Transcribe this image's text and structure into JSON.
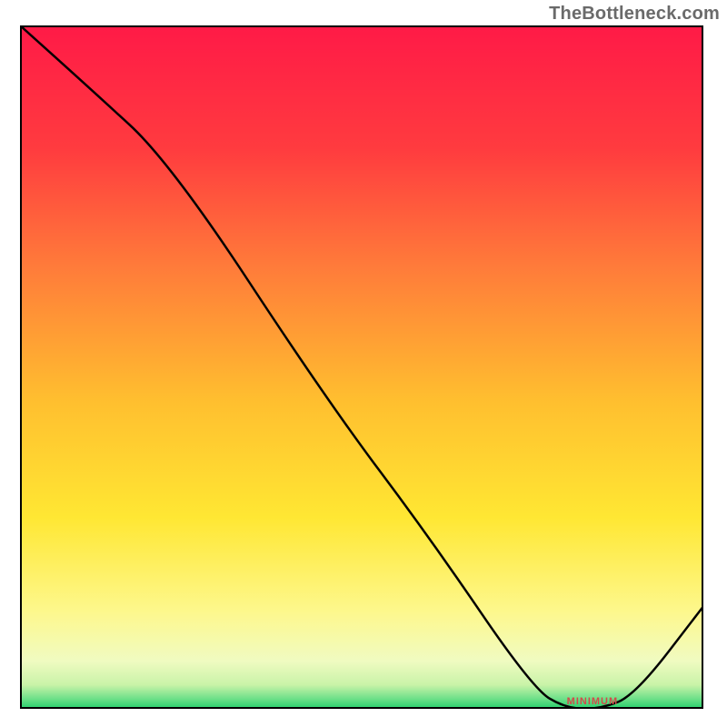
{
  "attribution": "TheBottleneck.com",
  "chart_data": {
    "type": "line",
    "title": "",
    "xlabel": "",
    "ylabel": "",
    "xlim": [
      0,
      100
    ],
    "ylim": [
      0,
      100
    ],
    "series": [
      {
        "name": "curve",
        "x": [
          0,
          10,
          22,
          45,
          60,
          75,
          80,
          85,
          90,
          100
        ],
        "y": [
          100,
          91,
          80,
          45,
          25,
          3,
          0,
          0,
          2,
          15
        ]
      }
    ],
    "minimum_region": {
      "x_start": 78,
      "x_end": 90,
      "y": 0
    },
    "minimum_label": "MINIMUM",
    "gradient_stops": [
      {
        "offset": 0.0,
        "color": "#ff1a47"
      },
      {
        "offset": 0.18,
        "color": "#ff3b3f"
      },
      {
        "offset": 0.35,
        "color": "#ff7a3a"
      },
      {
        "offset": 0.55,
        "color": "#ffbf2f"
      },
      {
        "offset": 0.72,
        "color": "#ffe733"
      },
      {
        "offset": 0.86,
        "color": "#fdf88e"
      },
      {
        "offset": 0.93,
        "color": "#f0fbc1"
      },
      {
        "offset": 0.965,
        "color": "#c9f3a8"
      },
      {
        "offset": 0.985,
        "color": "#6fe089"
      },
      {
        "offset": 1.0,
        "color": "#23cf6b"
      }
    ],
    "border_color": "#000000",
    "line_color": "#000000"
  }
}
